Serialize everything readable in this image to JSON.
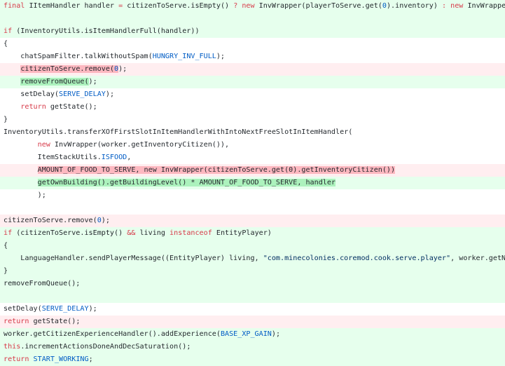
{
  "diff": {
    "lines": [
      {
        "type": "add",
        "segments": [
          {
            "t": "final",
            "k": "kw"
          },
          {
            "t": " IItemHandler handler "
          },
          {
            "t": "=",
            "k": "kw"
          },
          {
            "t": " citizenToServe.isEmpty() "
          },
          {
            "t": "?",
            "k": "kw"
          },
          {
            "t": " "
          },
          {
            "t": "new",
            "k": "kw"
          },
          {
            "t": " InvWrapper(playerToServe.get("
          },
          {
            "t": "0",
            "k": "cst"
          },
          {
            "t": ").inventory) "
          },
          {
            "t": ":",
            "k": "kw"
          },
          {
            "t": " "
          },
          {
            "t": "new",
            "k": "kw"
          },
          {
            "t": " InvWrapper(citiz"
          }
        ]
      },
      {
        "type": "add",
        "segments": []
      },
      {
        "type": "add",
        "segments": [
          {
            "t": "if",
            "k": "kw"
          },
          {
            "t": " (InventoryUtils.isItemHandlerFull(handler))"
          }
        ]
      },
      {
        "type": "ctx",
        "segments": [
          {
            "t": "{"
          }
        ]
      },
      {
        "type": "ctx",
        "segments": [
          {
            "t": "    chatSpamFilter.talkWithoutSpam("
          },
          {
            "t": "HUNGRY_INV_FULL",
            "k": "cst"
          },
          {
            "t": ");"
          }
        ]
      },
      {
        "type": "del",
        "segments": [
          {
            "t": "    "
          },
          {
            "t": "citizenToServe.remove(",
            "k": "hl-del"
          },
          {
            "t": "0",
            "k": "hl-del cst"
          },
          {
            "t": ");"
          }
        ]
      },
      {
        "type": "add",
        "segments": [
          {
            "t": "    "
          },
          {
            "t": "removeFromQueue(",
            "k": "hl-add"
          },
          {
            "t": ");"
          }
        ]
      },
      {
        "type": "ctx",
        "segments": [
          {
            "t": "    setDelay("
          },
          {
            "t": "SERVE_DELAY",
            "k": "cst"
          },
          {
            "t": ");"
          }
        ]
      },
      {
        "type": "ctx",
        "segments": [
          {
            "t": "    "
          },
          {
            "t": "return",
            "k": "kw"
          },
          {
            "t": " getState();"
          }
        ]
      },
      {
        "type": "ctx",
        "segments": [
          {
            "t": "}"
          }
        ]
      },
      {
        "type": "ctx",
        "segments": [
          {
            "t": "InventoryUtils.transferXOfFirstSlotInItemHandlerWithIntoNextFreeSlotInItemHandler("
          }
        ]
      },
      {
        "type": "ctx",
        "segments": [
          {
            "t": "        "
          },
          {
            "t": "new",
            "k": "kw"
          },
          {
            "t": " InvWrapper(worker.getInventoryCitizen()),"
          }
        ]
      },
      {
        "type": "ctx",
        "segments": [
          {
            "t": "        ItemStackUtils."
          },
          {
            "t": "ISFOOD",
            "k": "cst"
          },
          {
            "t": ","
          }
        ]
      },
      {
        "type": "del",
        "segments": [
          {
            "t": "        "
          },
          {
            "t": "AMOUNT_OF_FOOD_TO_SERVE, new InvWrapper(citizenToServe.get(0).getInventoryCitizen())",
            "k": "hl-del"
          }
        ]
      },
      {
        "type": "add",
        "segments": [
          {
            "t": "        "
          },
          {
            "t": "getOwnBuilding().getBuildingLevel() * AMOUNT_OF_FOOD_TO_SERVE, handler",
            "k": "hl-add"
          }
        ]
      },
      {
        "type": "ctx",
        "segments": [
          {
            "t": "        );"
          }
        ]
      },
      {
        "type": "ctx",
        "segments": []
      },
      {
        "type": "del",
        "segments": [
          {
            "t": "citizenToServe.remove("
          },
          {
            "t": "0",
            "k": "cst"
          },
          {
            "t": ");"
          }
        ]
      },
      {
        "type": "add",
        "segments": [
          {
            "t": "if",
            "k": "kw"
          },
          {
            "t": " (citizenToServe.isEmpty() "
          },
          {
            "t": "&&",
            "k": "kw"
          },
          {
            "t": " living "
          },
          {
            "t": "instanceof",
            "k": "kw"
          },
          {
            "t": " EntityPlayer)"
          }
        ]
      },
      {
        "type": "add",
        "segments": [
          {
            "t": "{"
          }
        ]
      },
      {
        "type": "add",
        "segments": [
          {
            "t": "    LanguageHandler.sendPlayerMessage((EntityPlayer) living, "
          },
          {
            "t": "\"com.minecolonies.coremod.cook.serve.player\"",
            "k": "str"
          },
          {
            "t": ", worker.getName())"
          }
        ]
      },
      {
        "type": "add",
        "segments": [
          {
            "t": "}"
          }
        ]
      },
      {
        "type": "add",
        "segments": [
          {
            "t": "removeFromQueue();"
          }
        ]
      },
      {
        "type": "add",
        "segments": []
      },
      {
        "type": "ctx",
        "segments": [
          {
            "t": "setDelay("
          },
          {
            "t": "SERVE_DELAY",
            "k": "cst"
          },
          {
            "t": ");"
          }
        ]
      },
      {
        "type": "del",
        "segments": [
          {
            "t": "return",
            "k": "kw"
          },
          {
            "t": " getState();"
          }
        ]
      },
      {
        "type": "add",
        "segments": [
          {
            "t": "worker.getCitizenExperienceHandler().addExperience("
          },
          {
            "t": "BASE_XP_GAIN",
            "k": "cst"
          },
          {
            "t": ");"
          }
        ]
      },
      {
        "type": "add",
        "segments": [
          {
            "t": "this",
            "k": "kw"
          },
          {
            "t": ".incrementActionsDoneAndDecSaturation();"
          }
        ]
      },
      {
        "type": "add",
        "segments": [
          {
            "t": "return",
            "k": "kw"
          },
          {
            "t": " "
          },
          {
            "t": "START_WORKING",
            "k": "cst"
          },
          {
            "t": ";"
          }
        ]
      }
    ]
  }
}
